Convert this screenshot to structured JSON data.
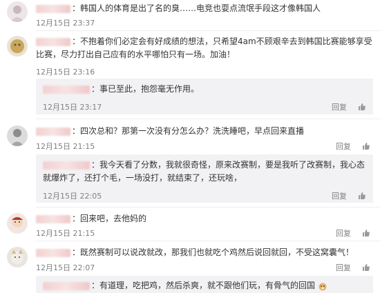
{
  "comments": [
    {
      "text": "：韩国人的体育是出了名的臭……电竞也耍点流氓手段这才像韩国人",
      "time": "12月15日 23:37"
    },
    {
      "text": "：不抱着你们必定会有好成绩的想法，只希望4am不顾艰辛去到韩国比赛能够享受比赛，尽力打出自己应有的水平哪怕只有一场。加油！",
      "time": "12月15日 23:16",
      "reply_label": "回复"
    },
    {
      "text": "：事已至此，抱怨毫无作用。",
      "time": "12月15日 23:17",
      "reply_label": "回复"
    },
    {
      "text": "：四次总和？那第一次没有分怎么办？洗洗睡吧，早点回来直播",
      "time": "12月15日 21:15",
      "reply_label": "回复"
    },
    {
      "text": "：我今天看了分数，我就很奇怪，原来改赛制，要是我听了改赛制，我心态就爆炸了，还打个毛，一场没打，就结束了，还玩啥，",
      "time": "12月15日 22:05",
      "reply_label": "回复"
    },
    {
      "text": "：回来吧，去他妈的",
      "time": "12月15日 21:15",
      "reply_label": "回复"
    },
    {
      "text": "：既然赛制可以说改就改，那我们也就吃个鸡然后说回就回，不受这窝囊气！",
      "time": "12月15日 22:07",
      "reply_label": "回复"
    },
    {
      "text": "：有道理，吃把鸡，然后杀爽，就不跟他们玩，有骨气的回国"
    }
  ],
  "colors": {
    "meta": "#808080",
    "reply_bg": "#f2f2f5",
    "text": "#333333"
  },
  "icons": [
    "thumbs-up-icon"
  ]
}
